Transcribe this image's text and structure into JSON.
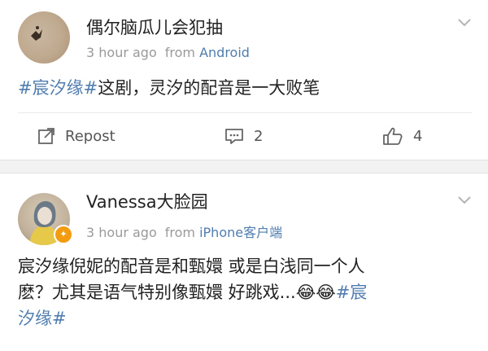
{
  "post1": {
    "username": "偶尔脑瓜儿会犯抽",
    "time": "3 hour ago",
    "from_label": "from",
    "source": "Android",
    "hashtag": "#宸汐缘#",
    "text": "这剧，灵汐的配音是一大败笔",
    "actions": {
      "repost_label": "Repost",
      "comment_count": "2",
      "like_count": "4"
    }
  },
  "post2": {
    "username": "Vanessa大脸园",
    "time": "3 hour ago",
    "from_label": "from",
    "source": "iPhone客户端",
    "text_line1": "宸汐缘倪妮的配音是和甄嬛 或是白浅同一个人",
    "text_line2": "麽？尤其是语气特别像甄嬛 好跳戏...",
    "emoji": [
      "😂",
      "😂"
    ],
    "hashtag_part1": "#宸",
    "hashtag_part2": "汐缘#"
  },
  "colors": {
    "link": "#507daf",
    "verified_badge": "#f39c12"
  }
}
